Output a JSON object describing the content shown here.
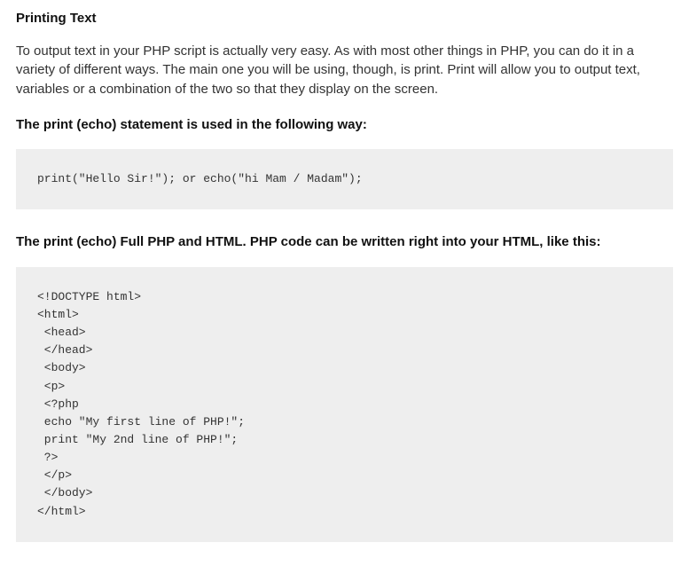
{
  "section": {
    "title": "Printing Text",
    "intro": "To output text in your PHP script is actually very easy. As with most other things in PHP, you can do it in a variety of different ways. The main one you will be using, though, is print. Print will allow you to output text, variables or a combination of the two so that they display on the screen.",
    "sub1": "The print (echo) statement is used in the following way:",
    "code1": "print(\"Hello Sir!\"); or echo(\"hi Mam / Madam\");",
    "sub2": "The print (echo) Full PHP and HTML. PHP code can be written right into your HTML, like this:",
    "code2": "<!DOCTYPE html>\n<html>\n <head>\n </head>\n <body>\n <p>\n <?php\n echo \"My first line of PHP!\";\n print \"My 2nd line of PHP!\";\n ?>\n </p>\n </body>\n</html>"
  }
}
